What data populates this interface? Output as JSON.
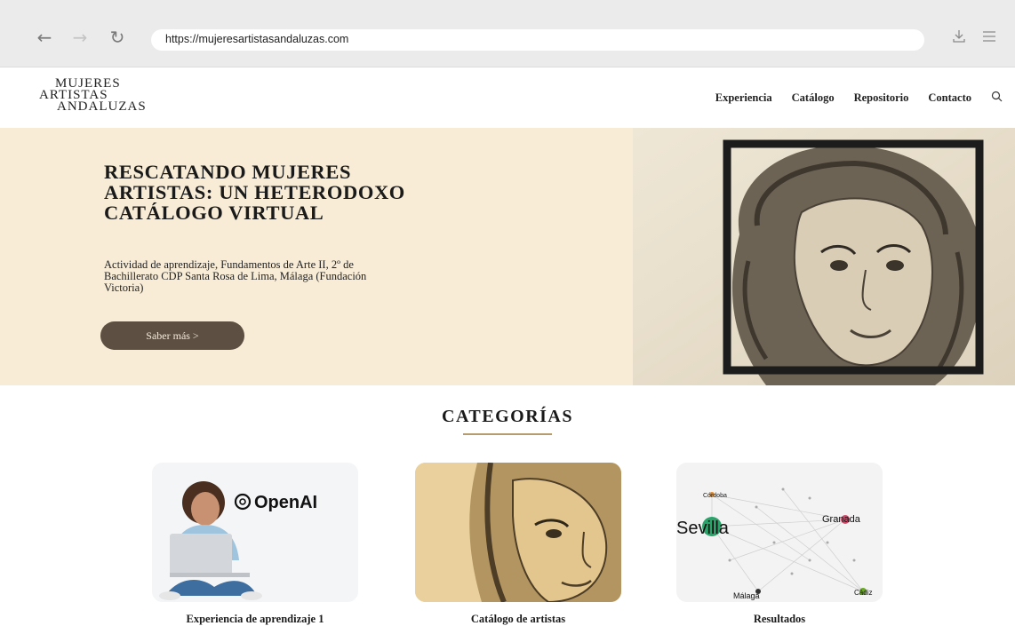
{
  "browser": {
    "url": "https://mujeresartistasandaluzas.com",
    "icons": [
      "back-arrow-icon",
      "forward-arrow-icon",
      "reload-icon",
      "download-icon",
      "menu-icon"
    ]
  },
  "site": {
    "logo": [
      "MUJERES",
      "ARTISTAS",
      "ANDALUZAS"
    ],
    "nav": [
      "Experiencia",
      "Catálogo",
      "Repositorio",
      "Contacto"
    ]
  },
  "hero": {
    "title": "RESCATANDO MUJERES ARTISTAS: UN HETERODOXO CATÁLOGO VIRTUAL",
    "subtitle": "Actividad de aprendizaje, Fundamentos de Arte II, 2º de Bachillerato CDP Santa Rosa de Lima, Málaga (Fundación Victoria)",
    "button": "Saber más >",
    "colors": {
      "background": "#f8ecd6",
      "button": "#5d5042"
    }
  },
  "categories": {
    "heading": "CATEGORÍAS",
    "cards": [
      {
        "label": "Experiencia de aprendizaje 1",
        "image_text": "OpenAI"
      },
      {
        "label": "Catálogo de artistas"
      },
      {
        "label": "Resultados",
        "image_text": [
          "Córdoba",
          "Sevilla",
          "Granada",
          "Málaga",
          "Cádiz"
        ]
      }
    ]
  }
}
